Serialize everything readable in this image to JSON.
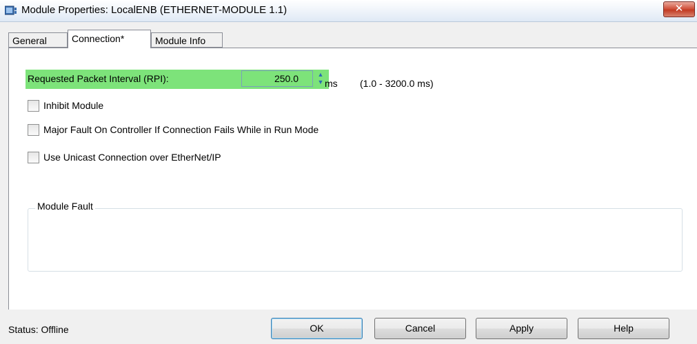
{
  "window": {
    "title": "Module Properties: LocalENB (ETHERNET-MODULE 1.1)",
    "close_label": "✕"
  },
  "tabs": [
    {
      "label": "General",
      "active": false
    },
    {
      "label": "Connection*",
      "active": true
    },
    {
      "label": "Module Info",
      "active": false
    }
  ],
  "connection": {
    "rpi_label": "Requested Packet Interval (RPI):",
    "rpi_value": "250.0",
    "rpi_unit": "ms",
    "rpi_range": "(1.0 - 3200.0 ms)",
    "highlight_color": "#7de37a",
    "checkboxes": [
      {
        "label": "Inhibit Module",
        "checked": false
      },
      {
        "label": "Major Fault On Controller If Connection Fails While in Run Mode",
        "checked": false
      },
      {
        "label": "Use Unicast Connection over EtherNet/IP",
        "checked": false
      }
    ],
    "module_fault_label": "Module Fault"
  },
  "footer": {
    "status": "Status: Offline",
    "buttons": {
      "ok": "OK",
      "cancel": "Cancel",
      "apply": "Apply",
      "help": "Help"
    }
  }
}
